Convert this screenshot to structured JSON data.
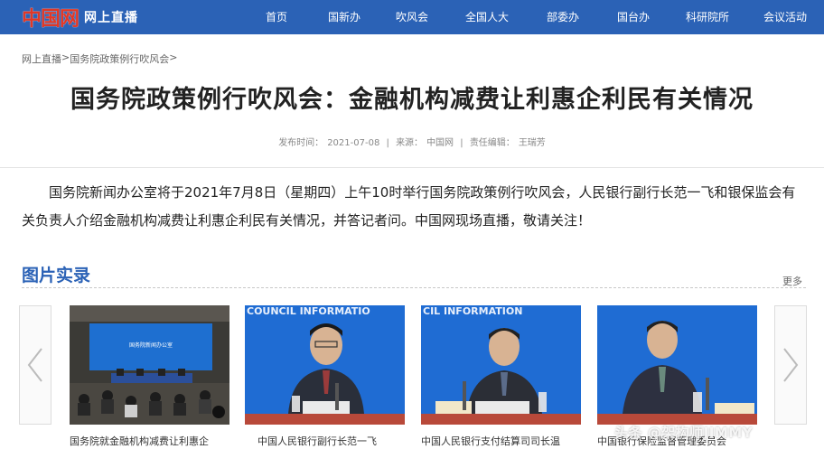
{
  "header": {
    "logo_mark": "中国网",
    "logo_sub": "网上直播",
    "nav": [
      "首页",
      "国新办",
      "吹风会",
      "全国人大",
      "部委办",
      "国台办",
      "科研院所",
      "会议活动"
    ]
  },
  "breadcrumb": [
    "网上直播",
    ">",
    "国务院政策例行吹风会",
    ">"
  ],
  "article": {
    "title": "国务院政策例行吹风会：金融机构减费让利惠企利民有关情况",
    "meta": {
      "date_label": "发布时间：",
      "date": "2021-07-08",
      "sep1": "|",
      "source_label": "来源：",
      "source": "中国网",
      "sep2": "|",
      "editor_label": "责任编辑：",
      "editor": "王瑞芳"
    },
    "intro": "国务院新闻办公室将于2021年7月8日（星期四）上午10时举行国务院政策例行吹风会，人民银行副行长范一飞和银保监会有关负责人介绍金融机构减费让利惠企利民有关情况，并答记者问。中国网现场直播，敬请关注！"
  },
  "gallery": {
    "title": "图片实录",
    "more": "更多",
    "items": [
      {
        "caption": "国务院就金融机构减费让利惠企",
        "screen_text": "国务院新闻办公室"
      },
      {
        "caption": "中国人民银行副行长范一飞",
        "banner": "COUNCIL INFORMATIO"
      },
      {
        "caption": "中国人民银行支付结算司司长温",
        "banner": "CIL INFORMATION"
      },
      {
        "caption": "中国银行保险监督管理委员会",
        "banner": ""
      }
    ]
  },
  "watermark": "头条 @架构师JIMMY",
  "colors": {
    "topbar": "#2b62b6",
    "logo_red": "#e13826",
    "section_blue": "#2b62b6"
  }
}
